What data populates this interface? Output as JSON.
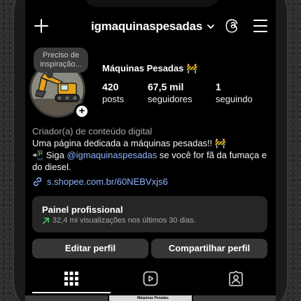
{
  "header": {
    "username": "igmaquinaspesadas"
  },
  "note": {
    "text": "Preciso de inspiração..."
  },
  "profile": {
    "display_name": "Máquinas Pesadas 🚧",
    "stats": [
      {
        "value": "420",
        "label": "posts"
      },
      {
        "value": "67,5 mil",
        "label": "seguidores"
      },
      {
        "value": "1",
        "label": "seguindo"
      }
    ],
    "category": "Criador(a) de conteúdo digital",
    "bio_line1": "Uma página dedicada a máquinas pesadas!! 🚧",
    "bio_line2_prefix": "📲 Siga ",
    "bio_mention": "@igmaquinaspesadas",
    "bio_line2_suffix": " se você for fã da fumaça e do diesel.",
    "link": "s.shopee.com.br/60NEBVxjs6"
  },
  "dashboard": {
    "title": "Painel profissional",
    "subtitle": "32,4 mi visualizações nos últimos 30 dias."
  },
  "buttons": {
    "edit": "Editar perfil",
    "share": "Compartilhar perfil"
  },
  "grid_preview": {
    "caption": "Máquinas Pesadas"
  },
  "colors": {
    "background": "#000000",
    "button": "#363636",
    "link": "#8fb4ff",
    "trend": "#4cd964"
  }
}
